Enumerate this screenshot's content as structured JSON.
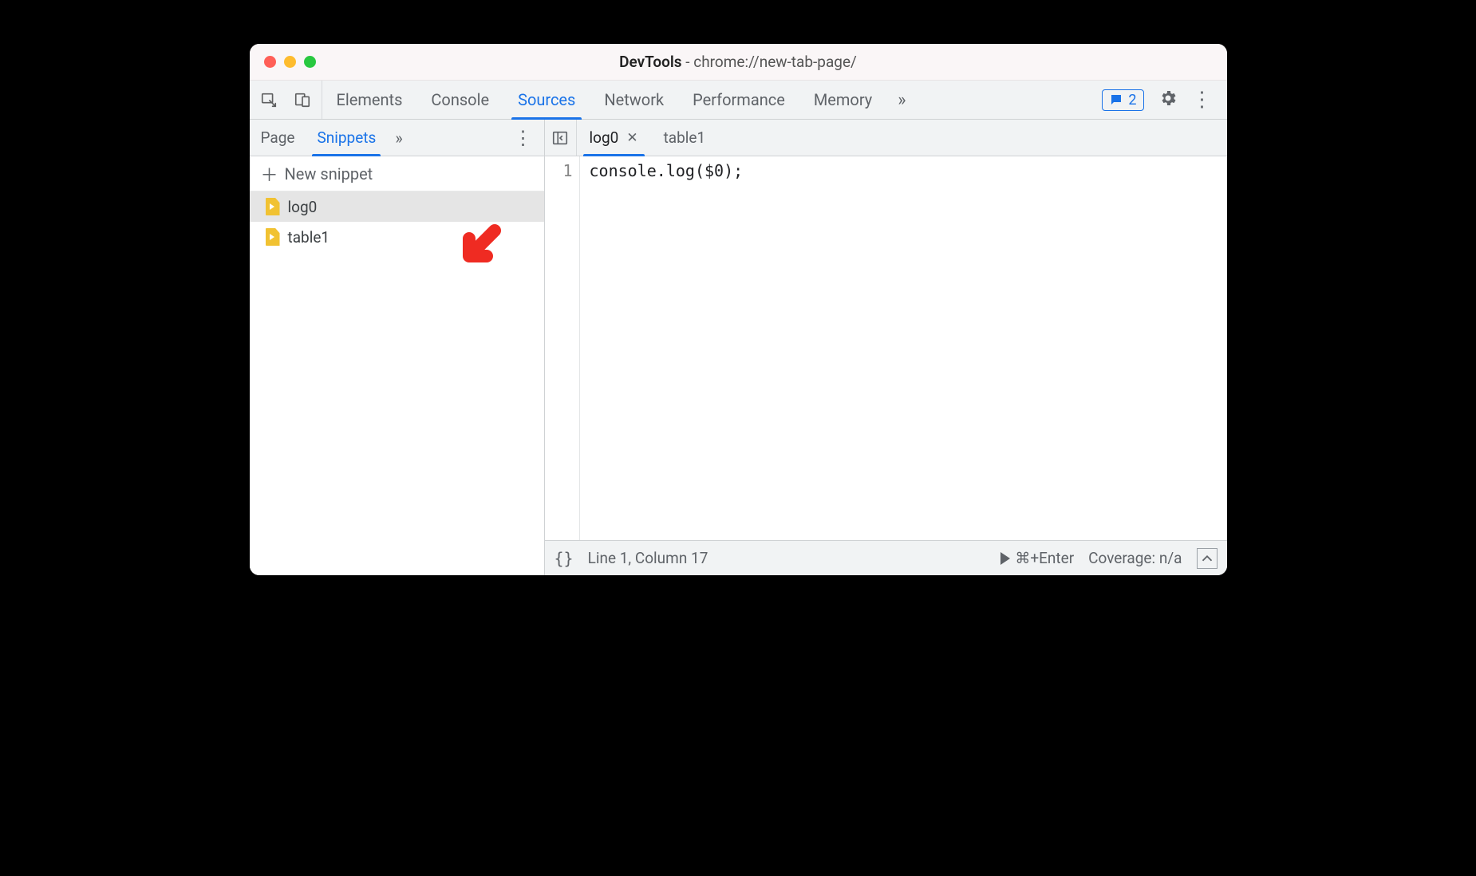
{
  "window": {
    "app_name": "DevTools",
    "subtitle": "chrome://new-tab-page/"
  },
  "toolbar": {
    "tabs": [
      "Elements",
      "Console",
      "Sources",
      "Network",
      "Performance",
      "Memory"
    ],
    "active_tab": "Sources",
    "message_count": "2",
    "overflow_glyph": "»"
  },
  "sidebar": {
    "tabs": [
      "Page",
      "Snippets"
    ],
    "active_tab": "Snippets",
    "overflow_glyph": "»",
    "new_snippet_label": "New snippet",
    "files": [
      {
        "name": "log0",
        "selected": true
      },
      {
        "name": "table1",
        "selected": false
      }
    ]
  },
  "editor": {
    "tabs": [
      {
        "name": "log0",
        "active": true,
        "closable": true
      },
      {
        "name": "table1",
        "active": false,
        "closable": false
      }
    ],
    "gutter": [
      "1"
    ],
    "code": "console.log($0);"
  },
  "statusbar": {
    "braces": "{}",
    "cursor": "Line 1, Column 17",
    "run_hint": "⌘+Enter",
    "coverage": "Coverage: n/a"
  }
}
